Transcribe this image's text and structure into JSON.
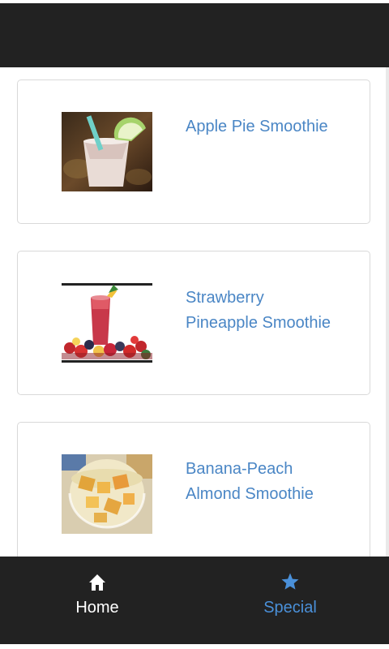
{
  "smoothies": [
    {
      "title_line1": "Apple Pie Smoothie",
      "title_line2": ""
    },
    {
      "title_line1": "Strawberry",
      "title_line2": "Pineapple Smoothie"
    },
    {
      "title_line1": "Banana-Peach",
      "title_line2": "Almond Smoothie"
    }
  ],
  "tabs": [
    {
      "label": "Home",
      "icon": "home-icon",
      "color": "#ffffff"
    },
    {
      "label": "Special",
      "icon": "star-icon",
      "color": "#4a90d9"
    }
  ],
  "colors": {
    "header_bg": "#222222",
    "link": "#4a86c5"
  }
}
